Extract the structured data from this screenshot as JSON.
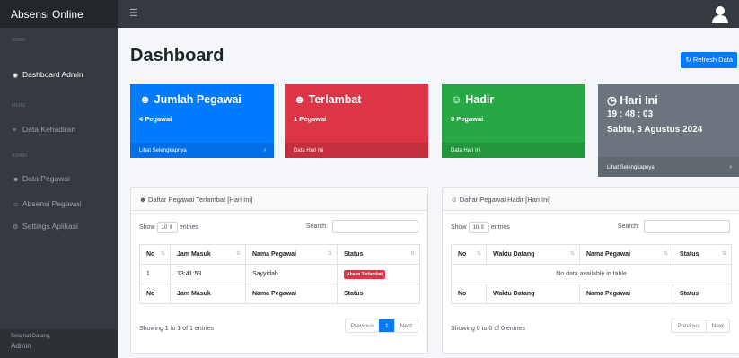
{
  "brand": "Absensi Online",
  "sidebar": {
    "sec_home": "HOME",
    "item_dashboard": "Dashboard Admin",
    "sec_menu": "MENU",
    "item_kehadiran": "Data Kehadiran",
    "sec_admin": "ADMIN",
    "item_pegawai": "Data Pegawai",
    "item_absensi": "Absensi Pegawai",
    "item_settings": "Settings Aplikasi",
    "footer_label": "Selamat Datang,",
    "footer_user": "Admin"
  },
  "page": {
    "title": "Dashboard",
    "refresh": "Refresh Data"
  },
  "cards": {
    "c1": {
      "title": "Jumlah Pegawai",
      "value": "4 Pegawai",
      "footer": "Lihat Selengkapnya"
    },
    "c2": {
      "title": "Terlambat",
      "value": "1 Pegawai",
      "footer": "Data Hari Ini"
    },
    "c3": {
      "title": "Hadir",
      "value": "0 Pegawai",
      "footer": "Data Hari Ini"
    },
    "c4": {
      "title": "Hari Ini",
      "time": "19 : 48 : 03",
      "date": "Sabtu, 3 Agustus 2024",
      "footer": "Lihat Selengkapnya"
    }
  },
  "colors": {
    "primary": "#007bff",
    "danger": "#dc3545",
    "success": "#28a745",
    "secondary": "#6c757d",
    "sidebar": "#343a40"
  },
  "late_table": {
    "header": "Daftar Pegawai Terlambat [Hari Ini]",
    "show": "Show",
    "entries_value": "10",
    "entries": "entries",
    "search": "Search:",
    "cols": [
      "No",
      "Jam Masuk",
      "Nama Pegawai",
      "Status"
    ],
    "rows": [
      {
        "no": "1",
        "jam": "13:41:53",
        "nama": "Sayyidah",
        "status": "Absen Terlambat"
      }
    ],
    "info": "Showing 1 to 1 of 1 entries",
    "prev": "Previous",
    "page": "1",
    "next": "Next"
  },
  "present_table": {
    "header": "Daftar Pegawai Hadir [Hari Ini]",
    "show": "Show",
    "entries_value": "10",
    "entries": "entries",
    "search": "Search:",
    "cols": [
      "No",
      "Waktu Datang",
      "Nama Pegawai",
      "Status"
    ],
    "empty": "No data available in table",
    "info": "Showing 0 to 0 of 0 entries",
    "prev": "Previous",
    "next": "Next"
  }
}
